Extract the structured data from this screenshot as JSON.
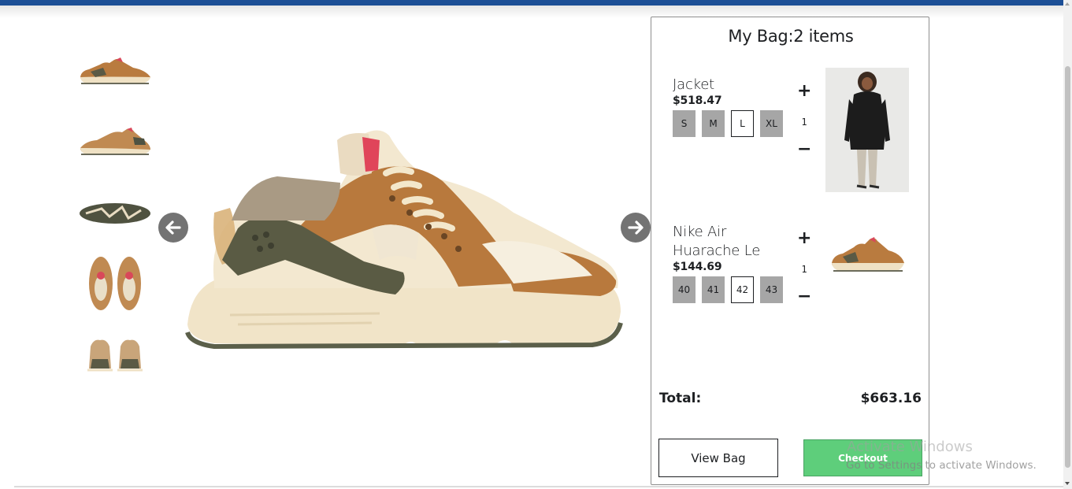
{
  "minibag": {
    "title": "My Bag:",
    "item_count": "2 items",
    "items": [
      {
        "name": "Jacket",
        "price": "$518.47",
        "sizes": [
          "S",
          "M",
          "L",
          "XL"
        ],
        "selected_size": "L",
        "qty_plus": "+",
        "quantity": "1",
        "qty_minus": "−"
      },
      {
        "name": "Nike Air Huarache Le",
        "price": "$144.69",
        "sizes": [
          "40",
          "41",
          "42",
          "43"
        ],
        "selected_size": "42",
        "qty_plus": "+",
        "quantity": "1",
        "qty_minus": "−"
      }
    ],
    "total_label": "Total:",
    "total_value": "$663.16",
    "view_bag_label": "View Bag",
    "checkout_label": "Checkout"
  },
  "gallery": {
    "thumbnail_count": 5,
    "prev_icon": "arrow-left-circle-icon",
    "next_icon": "arrow-right-circle-icon"
  },
  "colors": {
    "header": "#1c4f96",
    "checkout": "#5ece7b",
    "size_box": "#a6a6a6",
    "arrow_button": "#737373"
  },
  "watermark": {
    "title": "Activate Windows",
    "subtitle": "Go to Settings to activate Windows."
  }
}
